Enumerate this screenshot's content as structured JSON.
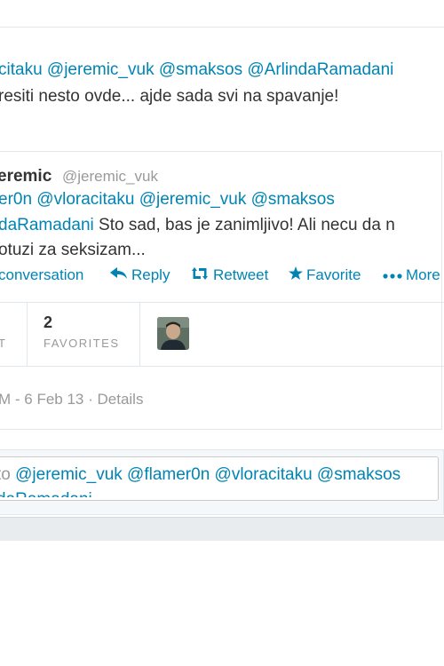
{
  "prev_tweet": {
    "line1_mentions": "citaku @jeremic_vuk @smaksos @ArlindaRamadani",
    "line2": "resiti nesto ovde... ajde sada svi na spavanje!"
  },
  "tweet": {
    "author_name": "eremic",
    "author_handle": "@jeremic_vuk",
    "body_line1": "er0n @vloracitaku @jeremic_vuk @smaksos",
    "body_line2_mention": "daRamadani",
    "body_line2_text": " Sto sad, bas je zanimljivo! Ali necu da n",
    "body_line3": "otuzi za seksizam...",
    "actions": {
      "conversation": "conversation",
      "reply": "Reply",
      "retweet": "Retweet",
      "favorite": "Favorite",
      "more": "More"
    },
    "stats": {
      "retweets_label_partial": "T",
      "favorites_count": "2",
      "favorites_label": "FAVORITES"
    },
    "timestamp": "M - 6 Feb 13",
    "details": "Details"
  },
  "reply": {
    "prefix": " to ",
    "mentions": "@jeremic_vuk @flamer0n @vloracitaku @smaksos",
    "line2": "daRamadani"
  },
  "icons": {
    "reply": "reply-arrow-icon",
    "retweet": "retweet-icon",
    "favorite": "star-icon",
    "more": "more-dots-icon"
  },
  "colors": {
    "link": "#0084b4",
    "muted": "#999999",
    "text": "#333333"
  }
}
